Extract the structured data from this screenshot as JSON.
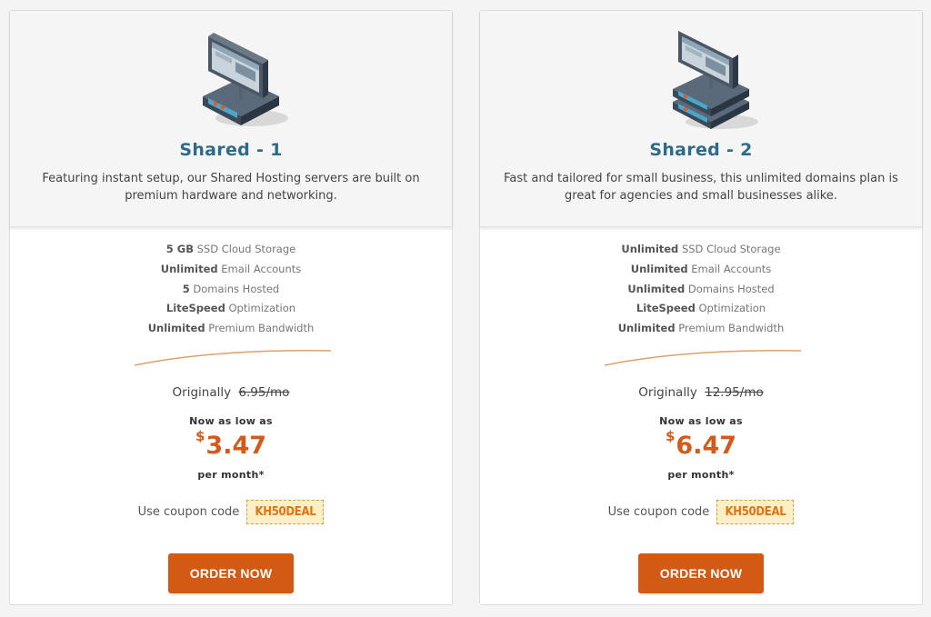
{
  "plans": [
    {
      "title": "Shared - 1",
      "description": "Featuring instant setup, our Shared Hosting servers are built on premium hardware and networking.",
      "icon": "server-monitor-icon",
      "features": [
        {
          "bold": "5 GB",
          "text": " SSD Cloud Storage"
        },
        {
          "bold": "Unlimited",
          "text": " Email Accounts"
        },
        {
          "bold": "5",
          "text": " Domains Hosted"
        },
        {
          "bold": "LiteSpeed",
          "text": " Optimization"
        },
        {
          "bold": "Unlimited",
          "text": " Premium Bandwidth"
        }
      ],
      "originally_label": "Originally",
      "original_price": "6.95/mo",
      "low_as_label": "Now as low as",
      "currency": "$",
      "price": "3.47",
      "per_month": "per month*",
      "coupon_label": "Use coupon code",
      "coupon_code": "KH50DEAL",
      "order_label": "ORDER NOW"
    },
    {
      "title": "Shared - 2",
      "description": "Fast and tailored for small business, this unlimited domains plan is great for agencies and small businesses alike.",
      "icon": "server-stack-monitor-icon",
      "features": [
        {
          "bold": "Unlimited",
          "text": " SSD Cloud Storage"
        },
        {
          "bold": "Unlimited",
          "text": " Email Accounts"
        },
        {
          "bold": "Unlimited",
          "text": " Domains Hosted"
        },
        {
          "bold": "LiteSpeed",
          "text": " Optimization"
        },
        {
          "bold": "Unlimited",
          "text": " Premium Bandwidth"
        }
      ],
      "originally_label": "Originally",
      "original_price": "12.95/mo",
      "low_as_label": "Now as low as",
      "currency": "$",
      "price": "6.47",
      "per_month": "per month*",
      "coupon_label": "Use coupon code",
      "coupon_code": "KH50DEAL",
      "order_label": "ORDER NOW"
    }
  ],
  "colors": {
    "title": "#2e6a8a",
    "price": "#d45a1c",
    "button": "#d25a14",
    "coupon_bg": "#fbefc5"
  }
}
